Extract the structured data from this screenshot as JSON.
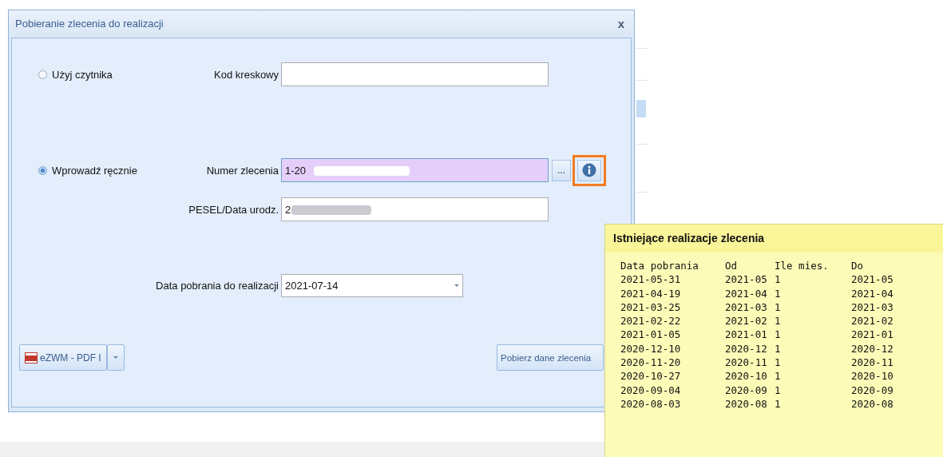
{
  "window": {
    "title": "Pobieranie zlecenia do realizacji",
    "close": "x"
  },
  "modes": [
    {
      "label": "Użyj czytnika",
      "selected": false
    },
    {
      "label": "Wprowadź ręcznie",
      "selected": true
    }
  ],
  "barcode": {
    "label": "Kod kreskowy"
  },
  "order_number": {
    "label": "Numer zlecenia",
    "value": "1-20",
    "redacted": true,
    "browse": "...",
    "info_highlighted": true
  },
  "pesel": {
    "label": "PESEL/Data urodz.",
    "value": "2",
    "redacted": true
  },
  "fetch_date": {
    "label": "Data pobrania do realizacji",
    "value": "2021-07-14"
  },
  "buttons": {
    "pdf": "eZWM - PDF I",
    "fetch": "Pobierz dane zlecenia"
  },
  "tooltip": {
    "title": "Istniejące realizacje zlecenia",
    "columns": [
      "Data pobrania",
      "Od",
      "Ile mies.",
      "Do"
    ],
    "rows": [
      [
        "2021-05-31",
        "2021-05",
        "1",
        "2021-05"
      ],
      [
        "2021-04-19",
        "2021-04",
        "1",
        "2021-04"
      ],
      [
        "2021-03-25",
        "2021-03",
        "1",
        "2021-03"
      ],
      [
        "2021-02-22",
        "2021-02",
        "1",
        "2021-02"
      ],
      [
        "2021-01-05",
        "2021-01",
        "1",
        "2021-01"
      ],
      [
        "2020-12-10",
        "2020-12",
        "1",
        "2020-12"
      ],
      [
        "2020-11-20",
        "2020-11",
        "1",
        "2020-11"
      ],
      [
        "2020-10-27",
        "2020-10",
        "1",
        "2020-10"
      ],
      [
        "2020-09-04",
        "2020-09",
        "1",
        "2020-09"
      ],
      [
        "2020-08-03",
        "2020-08",
        "1",
        "2020-08"
      ]
    ]
  }
}
